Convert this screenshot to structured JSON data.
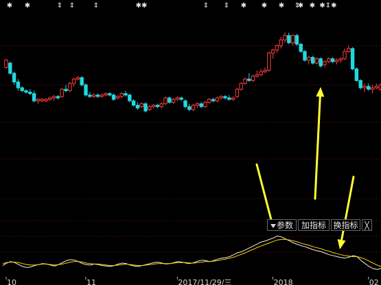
{
  "chart_data": [
    {
      "type": "candlestick",
      "title": "",
      "price_range": [
        3.0,
        13.0
      ],
      "x_labels": [
        {
          "index": 0,
          "label": "10"
        },
        {
          "index": 20,
          "label": "11"
        },
        {
          "index": 43,
          "label": "2017/11/29/三"
        },
        {
          "index": 67,
          "label": "2018"
        },
        {
          "index": 91,
          "label": "02"
        }
      ],
      "colors": {
        "up": "#ff3c3c",
        "down": "#20d8e0",
        "grid": "#8a0f0f"
      },
      "candles": [
        {
          "o": 9.3,
          "h": 9.9,
          "l": 9.2,
          "c": 9.8
        },
        {
          "o": 9.6,
          "h": 9.7,
          "l": 8.8,
          "c": 8.9
        },
        {
          "o": 8.9,
          "h": 9.0,
          "l": 8.1,
          "c": 8.3
        },
        {
          "o": 8.3,
          "h": 8.5,
          "l": 7.7,
          "c": 7.9
        },
        {
          "o": 7.9,
          "h": 8.0,
          "l": 7.6,
          "c": 7.7
        },
        {
          "o": 7.7,
          "h": 7.8,
          "l": 7.5,
          "c": 7.6
        },
        {
          "o": 7.6,
          "h": 7.8,
          "l": 7.4,
          "c": 7.5
        },
        {
          "o": 7.5,
          "h": 7.7,
          "l": 6.9,
          "c": 7.0
        },
        {
          "o": 7.0,
          "h": 7.2,
          "l": 6.8,
          "c": 7.1
        },
        {
          "o": 7.0,
          "h": 7.2,
          "l": 6.9,
          "c": 7.1
        },
        {
          "o": 7.0,
          "h": 7.2,
          "l": 6.9,
          "c": 7.1
        },
        {
          "o": 7.1,
          "h": 7.3,
          "l": 7.0,
          "c": 7.2
        },
        {
          "o": 7.2,
          "h": 7.4,
          "l": 7.0,
          "c": 7.3
        },
        {
          "o": 7.3,
          "h": 7.4,
          "l": 7.1,
          "c": 7.2
        },
        {
          "o": 7.3,
          "h": 7.9,
          "l": 7.2,
          "c": 7.8
        },
        {
          "o": 7.8,
          "h": 8.1,
          "l": 7.6,
          "c": 7.7
        },
        {
          "o": 7.7,
          "h": 8.3,
          "l": 7.6,
          "c": 8.2
        },
        {
          "o": 8.2,
          "h": 8.6,
          "l": 8.0,
          "c": 8.5
        },
        {
          "o": 8.5,
          "h": 8.7,
          "l": 8.4,
          "c": 8.6
        },
        {
          "o": 8.6,
          "h": 8.7,
          "l": 8.0,
          "c": 8.1
        },
        {
          "o": 8.1,
          "h": 8.2,
          "l": 7.3,
          "c": 7.4
        },
        {
          "o": 7.4,
          "h": 7.6,
          "l": 7.2,
          "c": 7.3
        },
        {
          "o": 7.3,
          "h": 7.5,
          "l": 7.2,
          "c": 7.4
        },
        {
          "o": 7.4,
          "h": 7.5,
          "l": 7.2,
          "c": 7.3
        },
        {
          "o": 7.3,
          "h": 7.5,
          "l": 7.2,
          "c": 7.4
        },
        {
          "o": 7.4,
          "h": 7.6,
          "l": 7.3,
          "c": 7.5
        },
        {
          "o": 7.5,
          "h": 7.6,
          "l": 7.3,
          "c": 7.4
        },
        {
          "o": 7.4,
          "h": 7.5,
          "l": 7.0,
          "c": 7.1
        },
        {
          "o": 7.2,
          "h": 7.4,
          "l": 7.1,
          "c": 7.3
        },
        {
          "o": 7.3,
          "h": 7.6,
          "l": 7.2,
          "c": 7.5
        },
        {
          "o": 7.5,
          "h": 7.7,
          "l": 7.3,
          "c": 7.4
        },
        {
          "o": 7.4,
          "h": 7.5,
          "l": 6.9,
          "c": 7.0
        },
        {
          "o": 7.0,
          "h": 7.1,
          "l": 6.6,
          "c": 6.7
        },
        {
          "o": 6.7,
          "h": 6.9,
          "l": 6.4,
          "c": 6.5
        },
        {
          "o": 6.6,
          "h": 6.9,
          "l": 6.5,
          "c": 6.8
        },
        {
          "o": 6.8,
          "h": 6.9,
          "l": 6.2,
          "c": 6.3
        },
        {
          "o": 6.4,
          "h": 6.7,
          "l": 6.3,
          "c": 6.6
        },
        {
          "o": 6.6,
          "h": 6.8,
          "l": 6.5,
          "c": 6.7
        },
        {
          "o": 6.7,
          "h": 6.8,
          "l": 6.5,
          "c": 6.6
        },
        {
          "o": 6.6,
          "h": 6.9,
          "l": 6.5,
          "c": 6.8
        },
        {
          "o": 6.8,
          "h": 7.3,
          "l": 6.7,
          "c": 7.2
        },
        {
          "o": 7.2,
          "h": 7.3,
          "l": 6.8,
          "c": 6.9
        },
        {
          "o": 6.9,
          "h": 7.2,
          "l": 6.8,
          "c": 7.1
        },
        {
          "o": 7.1,
          "h": 7.3,
          "l": 7.0,
          "c": 7.2
        },
        {
          "o": 7.2,
          "h": 7.3,
          "l": 7.0,
          "c": 7.1
        },
        {
          "o": 7.0,
          "h": 7.1,
          "l": 6.5,
          "c": 6.6
        },
        {
          "o": 6.6,
          "h": 6.8,
          "l": 6.3,
          "c": 6.4
        },
        {
          "o": 6.4,
          "h": 6.8,
          "l": 6.3,
          "c": 6.7
        },
        {
          "o": 6.7,
          "h": 6.9,
          "l": 6.5,
          "c": 6.8
        },
        {
          "o": 6.8,
          "h": 6.9,
          "l": 6.5,
          "c": 6.6
        },
        {
          "o": 6.6,
          "h": 7.0,
          "l": 6.5,
          "c": 6.9
        },
        {
          "o": 6.9,
          "h": 7.2,
          "l": 6.8,
          "c": 7.1
        },
        {
          "o": 7.1,
          "h": 7.2,
          "l": 6.9,
          "c": 7.0
        },
        {
          "o": 7.0,
          "h": 7.3,
          "l": 6.9,
          "c": 7.2
        },
        {
          "o": 7.2,
          "h": 7.4,
          "l": 7.1,
          "c": 7.3
        },
        {
          "o": 7.3,
          "h": 7.4,
          "l": 7.1,
          "c": 7.2
        },
        {
          "o": 7.2,
          "h": 7.4,
          "l": 7.0,
          "c": 7.1
        },
        {
          "o": 7.1,
          "h": 7.3,
          "l": 7.0,
          "c": 7.2
        },
        {
          "o": 7.3,
          "h": 7.9,
          "l": 7.2,
          "c": 7.8
        },
        {
          "o": 7.8,
          "h": 8.3,
          "l": 7.7,
          "c": 8.2
        },
        {
          "o": 8.2,
          "h": 8.6,
          "l": 8.1,
          "c": 8.5
        },
        {
          "o": 8.5,
          "h": 8.9,
          "l": 8.3,
          "c": 8.4
        },
        {
          "o": 8.4,
          "h": 8.8,
          "l": 8.3,
          "c": 8.7
        },
        {
          "o": 8.7,
          "h": 9.1,
          "l": 8.6,
          "c": 8.8
        },
        {
          "o": 8.8,
          "h": 9.2,
          "l": 8.7,
          "c": 9.0
        },
        {
          "o": 9.0,
          "h": 9.3,
          "l": 8.9,
          "c": 9.1
        },
        {
          "o": 9.1,
          "h": 10.4,
          "l": 9.0,
          "c": 10.3
        },
        {
          "o": 10.3,
          "h": 10.6,
          "l": 9.9,
          "c": 10.5
        },
        {
          "o": 10.5,
          "h": 10.9,
          "l": 10.3,
          "c": 10.8
        },
        {
          "o": 10.8,
          "h": 11.4,
          "l": 10.6,
          "c": 11.2
        },
        {
          "o": 11.2,
          "h": 11.7,
          "l": 11.0,
          "c": 11.5
        },
        {
          "o": 11.5,
          "h": 11.7,
          "l": 10.9,
          "c": 11.0
        },
        {
          "o": 11.0,
          "h": 11.6,
          "l": 10.8,
          "c": 11.5
        },
        {
          "o": 11.5,
          "h": 11.6,
          "l": 10.8,
          "c": 10.9
        },
        {
          "o": 10.9,
          "h": 11.0,
          "l": 10.3,
          "c": 10.4
        },
        {
          "o": 10.4,
          "h": 10.5,
          "l": 9.7,
          "c": 9.8
        },
        {
          "o": 9.8,
          "h": 10.1,
          "l": 9.5,
          "c": 10.0
        },
        {
          "o": 10.0,
          "h": 10.1,
          "l": 9.5,
          "c": 9.6
        },
        {
          "o": 9.6,
          "h": 10.0,
          "l": 9.5,
          "c": 9.9
        },
        {
          "o": 9.9,
          "h": 10.0,
          "l": 9.3,
          "c": 9.4
        },
        {
          "o": 9.5,
          "h": 9.8,
          "l": 9.3,
          "c": 9.7
        },
        {
          "o": 9.7,
          "h": 10.0,
          "l": 9.6,
          "c": 9.9
        },
        {
          "o": 9.9,
          "h": 10.0,
          "l": 9.6,
          "c": 9.7
        },
        {
          "o": 9.7,
          "h": 9.9,
          "l": 9.5,
          "c": 9.8
        },
        {
          "o": 9.8,
          "h": 10.0,
          "l": 9.6,
          "c": 9.9
        },
        {
          "o": 9.9,
          "h": 10.6,
          "l": 9.8,
          "c": 10.4
        },
        {
          "o": 10.4,
          "h": 10.8,
          "l": 10.3,
          "c": 10.6
        },
        {
          "o": 10.6,
          "h": 10.7,
          "l": 9.1,
          "c": 9.2
        },
        {
          "o": 9.2,
          "h": 9.3,
          "l": 8.3,
          "c": 8.4
        },
        {
          "o": 8.4,
          "h": 8.5,
          "l": 7.8,
          "c": 7.9
        },
        {
          "o": 7.9,
          "h": 8.2,
          "l": 7.6,
          "c": 8.0
        },
        {
          "o": 8.0,
          "h": 8.2,
          "l": 7.7,
          "c": 7.8
        },
        {
          "o": 7.8,
          "h": 8.1,
          "l": 7.5,
          "c": 7.9
        },
        {
          "o": 7.9,
          "h": 8.2,
          "l": 7.8,
          "c": 8.0
        },
        {
          "o": 7.8,
          "h": 8.2,
          "l": 7.7,
          "c": 8.1
        }
      ]
    },
    {
      "type": "line",
      "title": "",
      "y_range": [
        0,
        100
      ],
      "series": [
        {
          "color": "#f2f2f2",
          "values": [
            20,
            25,
            28,
            26,
            22,
            18,
            16,
            17,
            20,
            22,
            24,
            23,
            21,
            19,
            22,
            26,
            30,
            32,
            31,
            28,
            24,
            22,
            21,
            23,
            22,
            20,
            19,
            18,
            20,
            23,
            25,
            24,
            21,
            19,
            18,
            20,
            22,
            24,
            26,
            27,
            25,
            23,
            24,
            26,
            28,
            27,
            25,
            24,
            26,
            29,
            31,
            30,
            28,
            30,
            33,
            35,
            36,
            38,
            42,
            46,
            48,
            52,
            56,
            60,
            64,
            68,
            70,
            73,
            76,
            80,
            78,
            74,
            70,
            66,
            63,
            60,
            58,
            55,
            52,
            50,
            48,
            45,
            42,
            40,
            38,
            36,
            35,
            37,
            40,
            38,
            30,
            24,
            18,
            14,
            12,
            14
          ]
        },
        {
          "color": "#ffd700",
          "values": [
            24,
            26,
            27,
            27,
            26,
            24,
            22,
            21,
            21,
            22,
            23,
            23,
            22,
            21,
            22,
            23,
            25,
            27,
            28,
            28,
            27,
            25,
            24,
            23,
            23,
            22,
            21,
            20,
            20,
            21,
            22,
            23,
            22,
            21,
            20,
            20,
            21,
            22,
            23,
            24,
            24,
            24,
            24,
            25,
            26,
            26,
            26,
            25,
            25,
            26,
            27,
            28,
            28,
            29,
            30,
            32,
            33,
            35,
            37,
            40,
            43,
            46,
            50,
            53,
            57,
            60,
            63,
            66,
            69,
            72,
            73,
            73,
            72,
            70,
            68,
            65,
            63,
            61,
            58,
            56,
            54,
            51,
            49,
            46,
            44,
            42,
            40,
            39,
            38,
            38,
            36,
            33,
            29,
            25,
            21,
            18
          ]
        }
      ]
    }
  ],
  "indicator_toolbar": {
    "params_label": "参数",
    "add_indicator_label": "加指标",
    "swap_indicator_label": "换指标",
    "close_label": "╳"
  },
  "event_markers": {
    "top_row": [
      "✱",
      "✱",
      "⇕",
      "⇕",
      "⇕",
      "✱✱",
      "⇕",
      "⇕",
      "✱",
      "✱",
      "✱",
      "⇕",
      "✱",
      "✱",
      "✱⇕✱"
    ]
  },
  "annotation_color": "#ffff33"
}
